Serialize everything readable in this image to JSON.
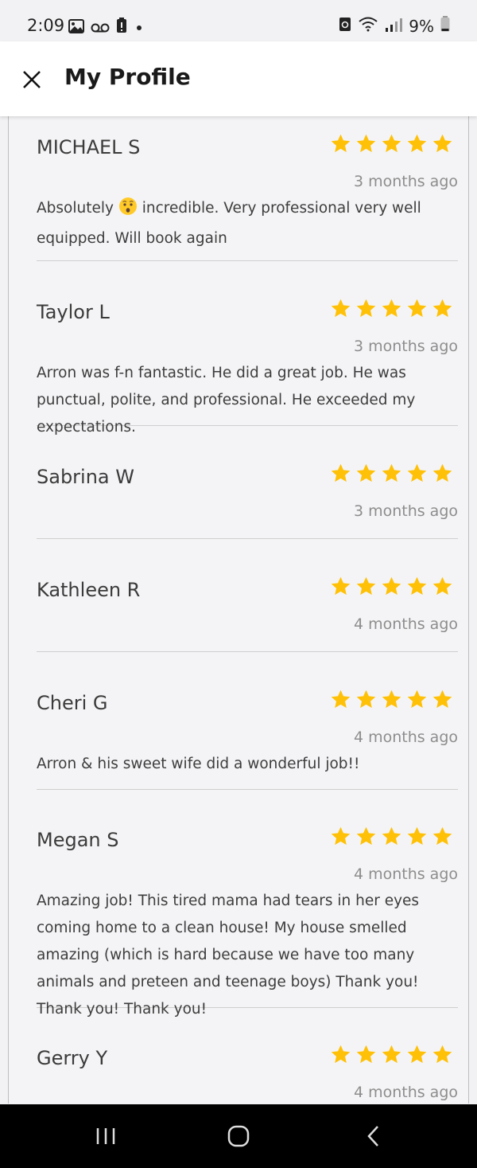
{
  "status_bar": {
    "time": "2:09",
    "battery": "9%",
    "icons": [
      "gallery-icon",
      "voicemail-icon",
      "alert-icon",
      "dot-icon",
      "sync-icon",
      "wifi-icon",
      "signal-icon",
      "battery-icon"
    ]
  },
  "header": {
    "title": "My Profile",
    "close_icon": "close-icon"
  },
  "reviews": [
    {
      "name": "MICHAEL S",
      "rating": 5,
      "ago": "3 months ago",
      "text_before": "Absolutely",
      "emoji": "hushed-face",
      "text_after": " incredible. Very professional very well equipped. Will book again"
    },
    {
      "name": "Taylor L",
      "rating": 5,
      "ago": "3 months ago",
      "text": "Arron was f-n fantastic. He did a great job. He was punctual, polite, and professional. He exceeded my expectations."
    },
    {
      "name": "Sabrina W",
      "rating": 5,
      "ago": "3 months ago",
      "text": ""
    },
    {
      "name": "Kathleen R",
      "rating": 5,
      "ago": "4 months ago",
      "text": ""
    },
    {
      "name": "Cheri G",
      "rating": 5,
      "ago": "4 months ago",
      "text": "Arron & his sweet wife did a wonderful job!!"
    },
    {
      "name": "Megan S",
      "rating": 5,
      "ago": "4 months ago",
      "text": "Amazing job! This tired mama had tears in her eyes coming home to a clean house! My house smelled amazing (which is hard because we have too many animals and preteen and teenage boys) Thank you! Thank you! Thank you!"
    },
    {
      "name": "Gerry Y",
      "rating": 5,
      "ago": "4 months ago",
      "text": ""
    }
  ],
  "colors": {
    "star": "#FFC107",
    "background": "#f2f2f4",
    "header": "#ffffff",
    "nav_bar": "#000000"
  },
  "nav_bar": {
    "buttons": [
      "recent-apps-icon",
      "home-icon",
      "back-icon"
    ]
  }
}
